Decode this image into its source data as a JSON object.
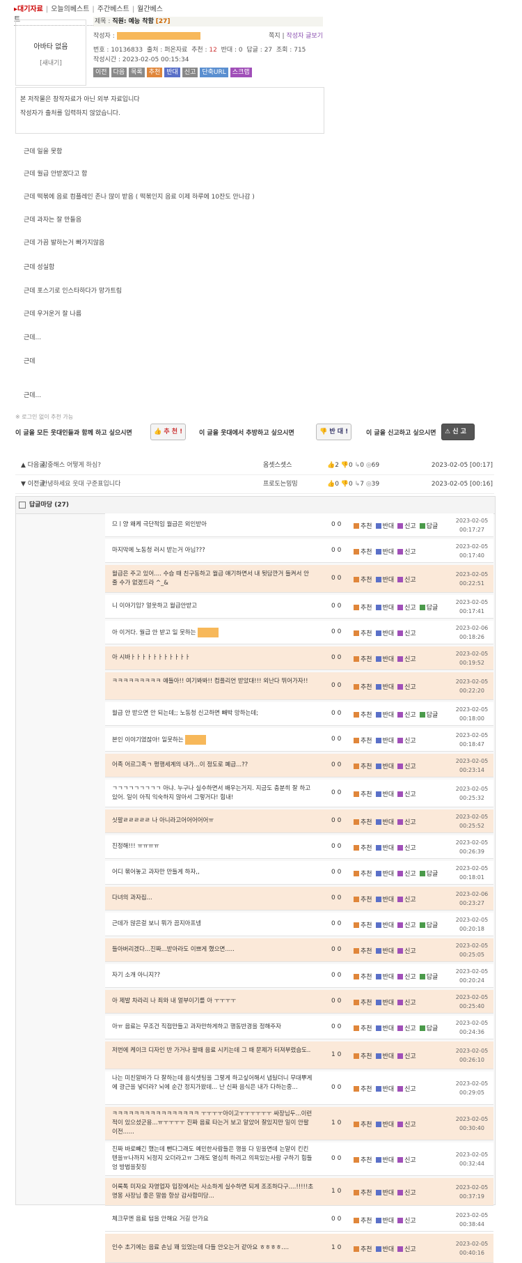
{
  "tabs": [
    {
      "label": "대기자료",
      "active": true
    },
    {
      "label": "오늘의베스트",
      "active": false
    },
    {
      "label": "주간베스트",
      "active": false
    },
    {
      "label": "월간베스트",
      "active": false
    }
  ],
  "profile": {
    "name": "아바타 없음",
    "badge": "[새내기]"
  },
  "post": {
    "title_prefix": "제목 : ",
    "title": "직원: 예능 착함",
    "comment_count_label": "[27]",
    "writer_label": "작성자 :",
    "message_label": "쪽지",
    "writer_posts_label": "작성자 글보기",
    "info": {
      "no_label": "번호 : ",
      "no": "10136833",
      "source_label": "출처 : ",
      "source": "퍼온자료",
      "rec_label": "추천 : ",
      "rec": "12",
      "oppose_label": "반대 : ",
      "oppose": "0",
      "reply_label": "답글 : ",
      "reply": "27",
      "views_label": "조회 : ",
      "views": "715"
    },
    "time_label": "작성시간 : ",
    "time": "2023-02-05 00:15:34"
  },
  "action_buttons": [
    {
      "label": "이전",
      "color": "#8a8a8a"
    },
    {
      "label": "다음",
      "color": "#8a8a8a"
    },
    {
      "label": "목록",
      "color": "#8a8a8a"
    },
    {
      "label": "추천",
      "color": "#e0863a"
    },
    {
      "label": "반대",
      "color": "#5a70c8"
    },
    {
      "label": "신고",
      "color": "#888888"
    },
    {
      "label": "단축URL",
      "color": "#5a8fd0"
    },
    {
      "label": "스크랩",
      "color": "#a04fb8"
    }
  ],
  "notice": [
    "본 저작물은 창작자료가 아닌 외부 자료입니다",
    "작성자가 출처를 입력하지 않았습니다."
  ],
  "body_lines": [
    "근데 일을 못함",
    "근데 월급 안받겠다고 함",
    "근데 떡볶에 음료 컴플레인 존나 많이 받음 ( 떡볶인지 음료 이제 하루에 10잔도 안나감 )",
    "근데 과자는 잘 만들음",
    "근데 가끔 발하는거 빠가지않음",
    "근데 성실함",
    "근데 포스기로 인스타하다가 망가트림",
    "근데 우거운거 잘 나름",
    "근데...",
    "근데",
    "근데..."
  ],
  "rec_note": "※ 로그인 없이 추천 가능",
  "votes": {
    "rec_prompt": "이 글을 모든 웃대인들과 함께 하고 싶으시면",
    "rec_btn": "추 천 !",
    "opp_prompt": "이 글을 웃대에서 추방하고 싶으시면",
    "opp_btn": "반 대 !",
    "rep_prompt": "이 글을 신고하고 싶으시면",
    "rep_btn": "신 고 !"
  },
  "prev_next": [
    {
      "dir": "▲ 다음글",
      "title": "잠중해스 어떻게 하심?",
      "author": "옴셋스셋스",
      "up": "2",
      "down": "0",
      "reply": "0",
      "views": "69",
      "date": "2023-02-05 [00:17]"
    },
    {
      "dir": "▼ 이전글",
      "title": "안녕하세요 웃대 구준표입니다",
      "author": "프로도는밍밍",
      "up": "0",
      "down": "0",
      "reply": "7",
      "views": "39",
      "date": "2023-02-05 [00:16]"
    }
  ],
  "comments_header": "답글마당 (27)",
  "comment_actions": {
    "rec": "추천",
    "opp": "반대",
    "rep": "신고",
    "reply": "답글"
  },
  "comments": [
    {
      "text": "므ㅣ양 왜케 극단적임 월급은 외인받아",
      "count": "0 0",
      "date": "2023-02-05",
      "time": "00:17:27",
      "reply": true,
      "shade": false
    },
    {
      "text": "마지막에 노동청 러시 받는거 아님???",
      "count": "0 0",
      "date": "2023-02-05",
      "time": "00:17:40",
      "reply": false,
      "shade": false
    },
    {
      "text": "월급은 주고 있어.... 수습 때 친구동하고 월급 얘기하면서 내 뒷담깐거 들켜서 안 줄 수가 없겠드라 ^_&",
      "count": "0 0",
      "date": "2023-02-05",
      "time": "00:22:51",
      "reply": false,
      "shade": true
    },
    {
      "text": "니 이야기임? 얼웃하고 월급안받고",
      "count": "0 0",
      "date": "2023-02-05",
      "time": "00:17:41",
      "reply": true,
      "shade": false
    },
    {
      "text": "아 이거다. 월급 안 받고 일 못하는",
      "count": "0 0",
      "date": "2023-02-06",
      "time": "00:18:26",
      "reply": false,
      "shade": false,
      "masked": true
    },
    {
      "text": "아 시바ㅏㅏㅏㅏㅏㅏㅏㅏㅏㅏㅏ",
      "count": "0 0",
      "date": "2023-02-05",
      "time": "00:19:52",
      "reply": false,
      "shade": true
    },
    {
      "text": "ㅋㅋㅋㅋㅋㅋㅋㅋㅋ 얘들아!! 여기봐봐!! 컴플리언 받았대!!! 외난다 뛰어가자!!",
      "count": "0 0",
      "date": "2023-02-05",
      "time": "00:22:20",
      "reply": false,
      "shade": true
    },
    {
      "text": "월급 안 받으면 안 되는데;; 노동청 신고하면 빼박 망하는데;",
      "count": "0 0",
      "date": "2023-02-05",
      "time": "00:18:00",
      "reply": true,
      "shade": false
    },
    {
      "text": "본인 이야기였잖아! 일못하는",
      "count": "0 0",
      "date": "2023-02-05",
      "time": "00:18:47",
      "reply": false,
      "shade": false,
      "masked": true
    },
    {
      "text": "어족 어르그족ㄱ 평행세계의 내가...이 정도로 폐급...??",
      "count": "0 0",
      "date": "2023-02-05",
      "time": "00:23:14",
      "reply": false,
      "shade": true
    },
    {
      "text": "ㄱㄱㄱㄱㄱㄱㄱㄱㄱ 아냐. 누구나 실수하면서 배우는거지. 지금도 충분히 잘 하고 있어. 일이 아직 익숙하지 않아서 그렇거다! 힘내!",
      "count": "0 0",
      "date": "2023-02-05",
      "time": "00:25:32",
      "reply": false,
      "shade": false
    },
    {
      "text": "싯팔ㄹㄹㄹㄹㄹ 나 아니라고어어어어어ㅠ",
      "count": "0 0",
      "date": "2023-02-05",
      "time": "00:25:52",
      "reply": false,
      "shade": true
    },
    {
      "text": "진정해!!! ㅠㅠㅠㅠ",
      "count": "0 0",
      "date": "2023-02-05",
      "time": "00:26:39",
      "reply": false,
      "shade": false
    },
    {
      "text": "어디 묶어놓고 과자만 만들게 하자,,",
      "count": "0 0",
      "date": "2023-02-05",
      "time": "00:18:01",
      "reply": true,
      "shade": false
    },
    {
      "text": "다녀의 과자집...",
      "count": "0 0",
      "date": "2023-02-06",
      "time": "00:23:27",
      "reply": false,
      "shade": true
    },
    {
      "text": "근데가 많은걸 보니 뭐가 끔지아프넹",
      "count": "0 0",
      "date": "2023-02-05",
      "time": "00:20:18",
      "reply": true,
      "shade": false
    },
    {
      "text": "들아버리겠다...진짜...받아라도 이쁘게 했으면.....",
      "count": "0 0",
      "date": "2023-02-05",
      "time": "00:25:05",
      "reply": false,
      "shade": true
    },
    {
      "text": "자기 소개 아니지??",
      "count": "0 0",
      "date": "2023-02-05",
      "time": "00:20:24",
      "reply": true,
      "shade": false
    },
    {
      "text": "아 제발 차라리 나 죄와 내 얼부이기를 아 ㅜㅜㅜㅜ",
      "count": "0 0",
      "date": "2023-02-05",
      "time": "00:25:40",
      "reply": false,
      "shade": true
    },
    {
      "text": "아ㅠ 음료는 무조건 직접만들고 과자만하게하고 행동반경을 정해주자",
      "count": "0 0",
      "date": "2023-02-05",
      "time": "00:24:36",
      "reply": true,
      "shade": false
    },
    {
      "text": "저번에 케이크 디자인 반 가거나 팔때 음료 시키는데 그 때 문제가 터져부렸슴도..",
      "count": "1 0",
      "date": "2023-02-05",
      "time": "00:26:10",
      "reply": false,
      "shade": true
    },
    {
      "text": "나는 미친알바가 다 잘하는데 음식셋팅을 그렇게 하고싶어해서 냅뒀더니 무대뿌게에 광근을 넣더라? 뇌에 순간 정지가왔데... 난 신짜 음식은 내가 다하는중...",
      "count": "0 0",
      "date": "2023-02-05",
      "time": "00:29:05",
      "reply": false,
      "shade": false
    },
    {
      "text": "ㅋㅋㅋㅋㅋㅋㅋㅋㅋㅋㅋㅋㅋㅋㅋㅋ ㅜㅜㅜㅜ아이고ㅜㅜㅜㅜㅜㅜ 싸장님두...이런 적이 있으셨군용...ㅠㅜㅜㅜㅜ 진짜 음료 타는거 보고 알았어 잘있지만 일이 안팔이전......",
      "count": "1 0",
      "date": "2023-02-05",
      "time": "00:30:40",
      "reply": false,
      "shade": true
    },
    {
      "text": "진짜 바로빼긴 했는데 뺀다그래도 예민한사람들은 행을 다 믿을면데 는말이 킨킨텐을ㅠ나까지 뇌정지 오더라고ㅠ 그래도 열심히 하려고 의욕있는사람 구하기 힘들엉 방법을찾징",
      "count": "0 0",
      "date": "2023-02-05",
      "time": "00:32:44",
      "reply": false,
      "shade": false
    },
    {
      "text": "어록톡 미자요 자영업자 입장에서는 사소하게 실수하면 되게 조조하다구....!!!!!초명몽 사장님 좋은 말씀 항상 감사합미당...",
      "count": "1 0",
      "date": "2023-02-05",
      "time": "00:37:19",
      "reply": false,
      "shade": true
    },
    {
      "text": "체크무엔 음료 텀을 안해요 거길 안가요",
      "count": "0 0",
      "date": "2023-02-05",
      "time": "00:38:44",
      "reply": false,
      "shade": false
    },
    {
      "text": "인수 초기에는 음료 손님 꽤 있었는데 다들 안오는거 같아요 ㅎㅎㅎㅎ....",
      "count": "1 0",
      "date": "2023-02-05",
      "time": "00:40:16",
      "reply": false,
      "shade": true
    }
  ]
}
